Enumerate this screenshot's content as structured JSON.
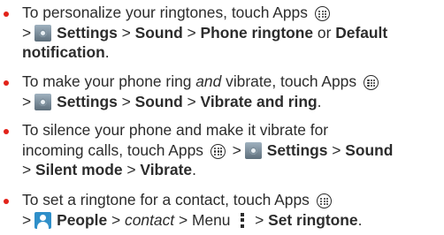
{
  "colors": {
    "bullet": "#e2231a",
    "text": "#2c2c2c"
  },
  "items": [
    {
      "l1_a": "To personalize your ringtones, touch Apps",
      "l2_gt": ">",
      "l2_b1": "Settings",
      "l2_gt2": ">",
      "l2_b2": "Sound",
      "l2_gt3": ">",
      "l2_b3": "Phone ringtone",
      "l2_or": "or",
      "l2_b4": "Default",
      "l3_b": "notification",
      "l3_end": "."
    },
    {
      "l1_a": "To make your phone ring",
      "l1_i": "and",
      "l1_b": "vibrate, touch Apps",
      "l2_gt": ">",
      "l2_b1": "Settings",
      "l2_gt2": ">",
      "l2_b2": "Sound",
      "l2_gt3": ">",
      "l2_b3": "Vibrate and ring",
      "l2_end": "."
    },
    {
      "l1_a": "To silence your phone and make it vibrate for",
      "l2_a": "incoming calls, touch Apps",
      "l2_gt": ">",
      "l2_b1": "Settings",
      "l2_gt2": ">",
      "l2_b2": "Sound",
      "l3_gt": ">",
      "l3_b1": "Silent mode",
      "l3_gt2": ">",
      "l3_b2": "Vibrate",
      "l3_end": "."
    },
    {
      "l1_a": "To set a ringtone for a contact, touch Apps",
      "l2_gt": ">",
      "l2_b1": "People",
      "l2_gt2": ">",
      "l2_i": "contact",
      "l2_gt3": ">",
      "l2_menu": "Menu",
      "l2_gt4": ">",
      "l2_b2": "Set ringtone",
      "l2_end": "."
    }
  ],
  "icons": {
    "apps": "apps-icon",
    "settings": "settings-icon",
    "people": "people-icon",
    "menu": "menu-icon"
  }
}
